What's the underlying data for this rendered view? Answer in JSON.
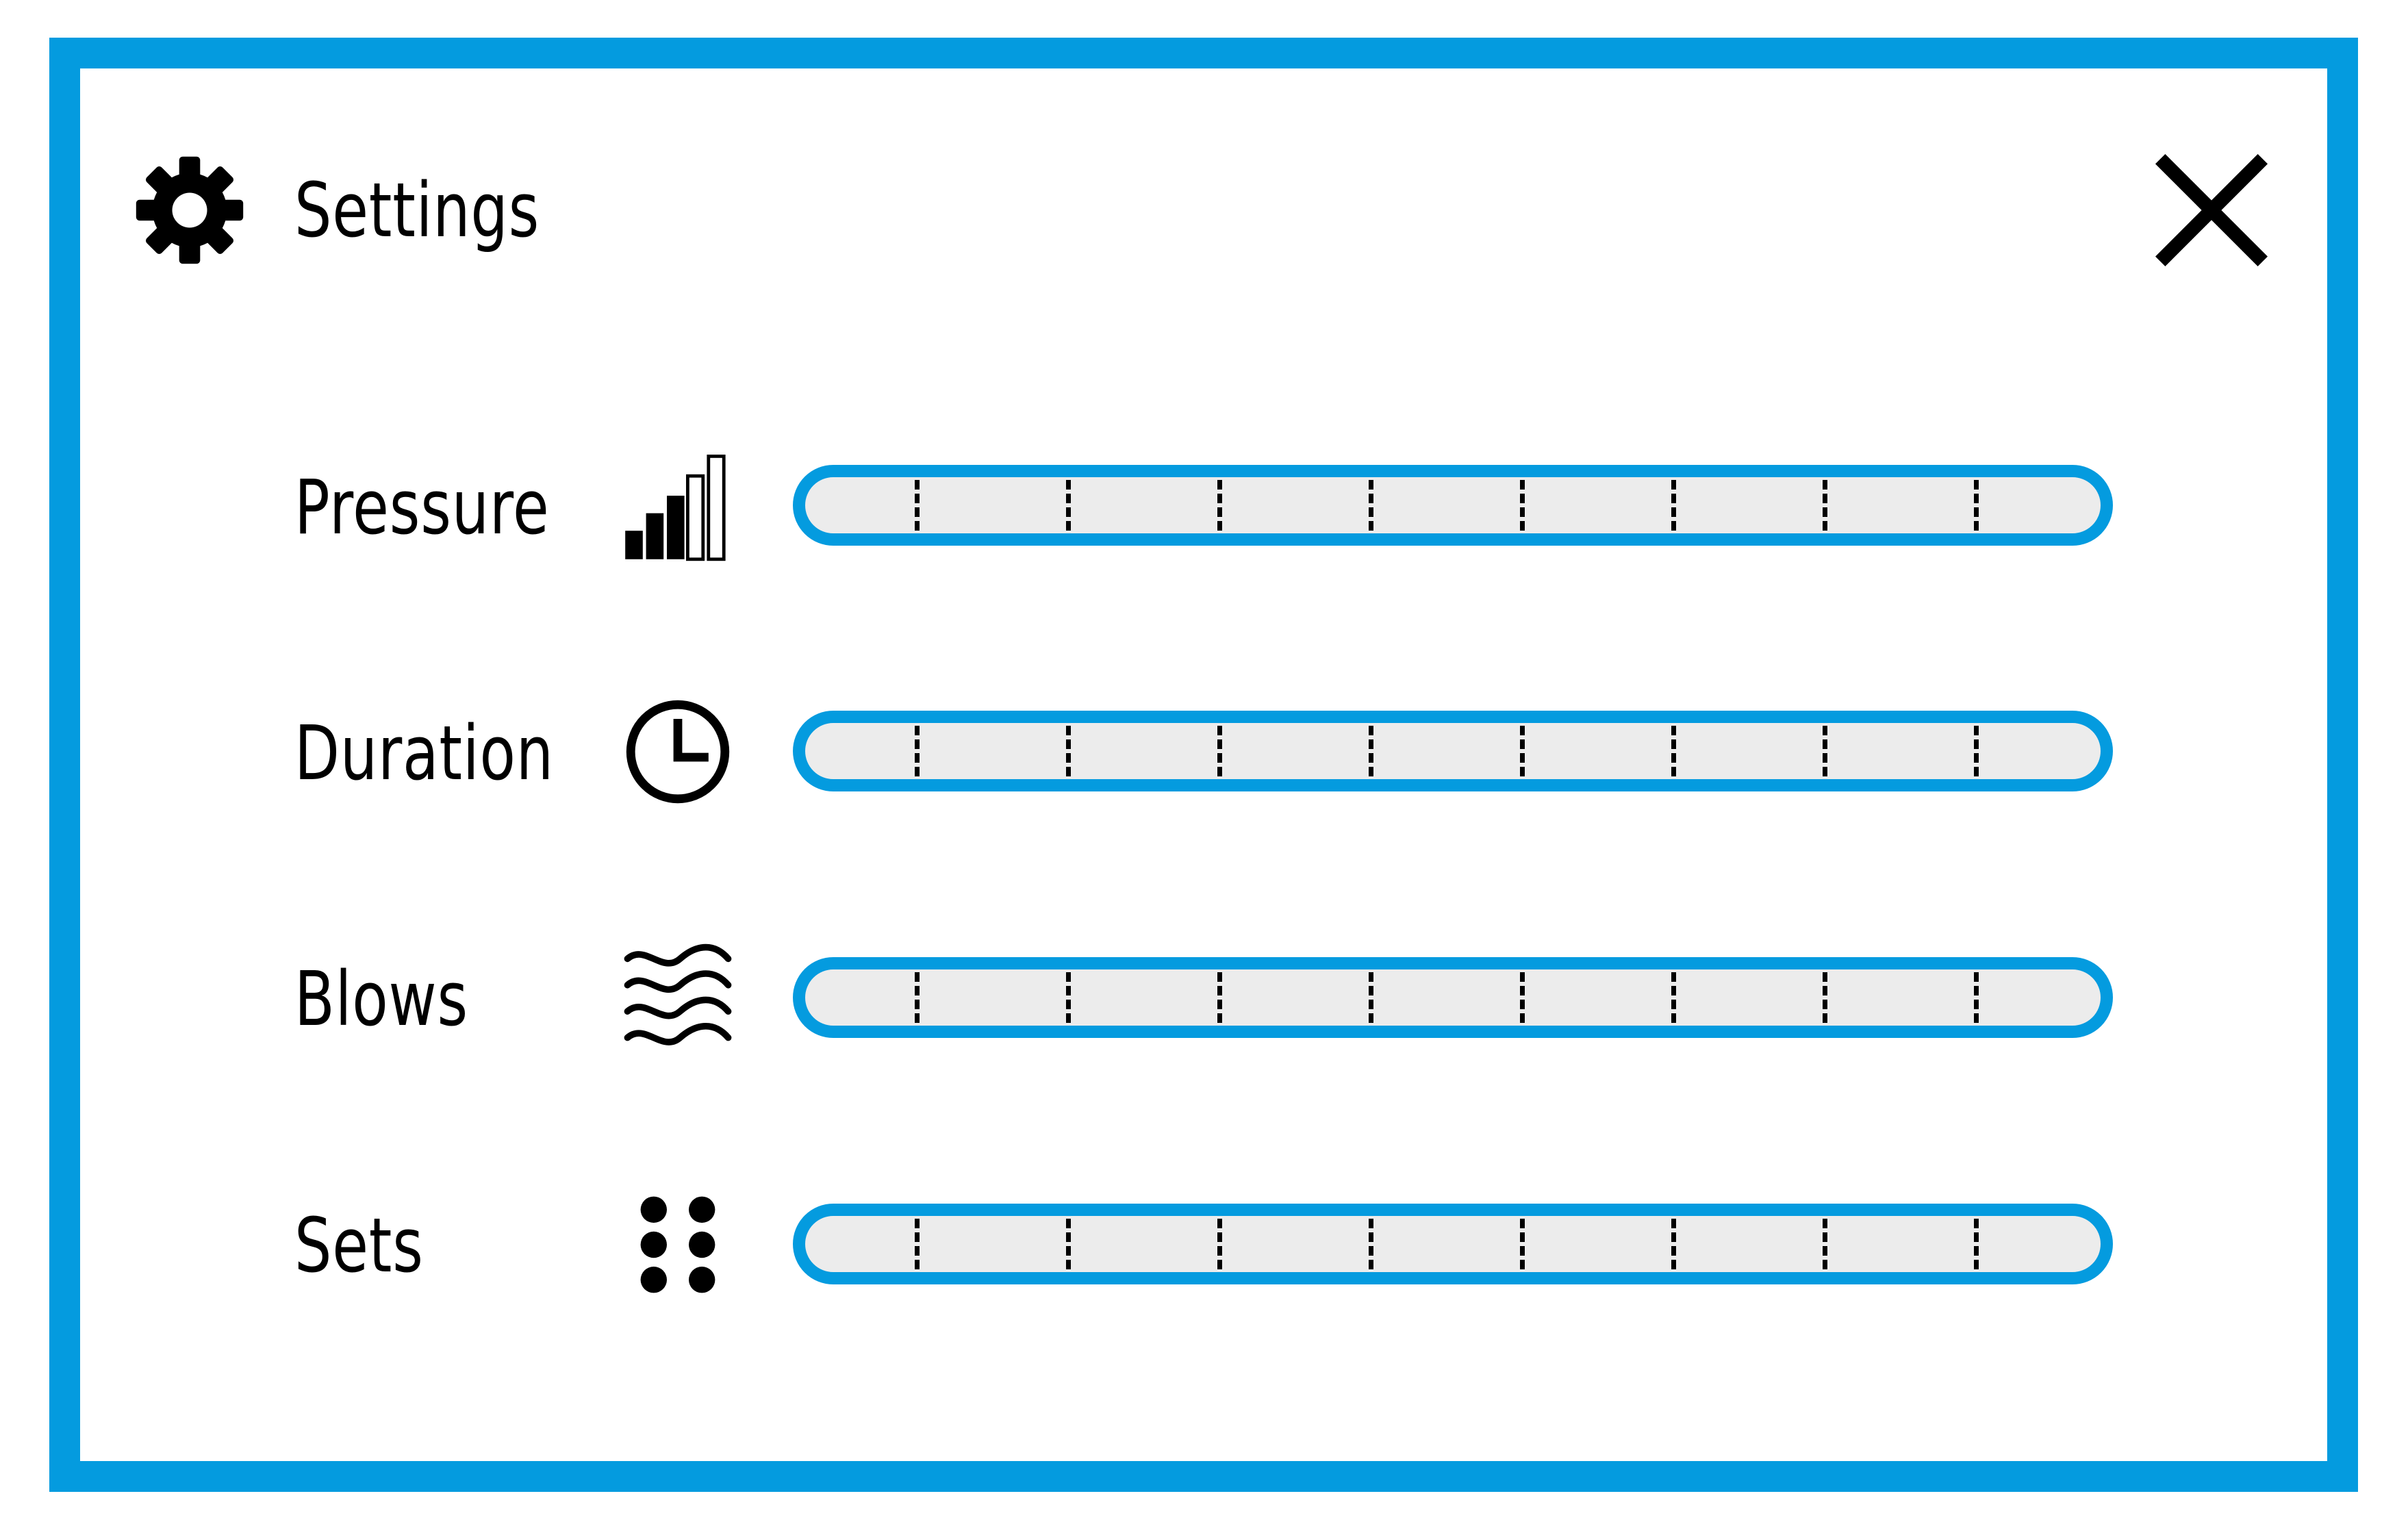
{
  "header": {
    "title": "Settings",
    "icon": "gear-icon",
    "close_icon": "close-icon"
  },
  "settings": [
    {
      "label": "Pressure",
      "icon": "signal-bars-icon"
    },
    {
      "label": "Duration",
      "icon": "clock-icon"
    },
    {
      "label": "Blows",
      "icon": "waves-icon"
    },
    {
      "label": "Sets",
      "icon": "dice-six-icon"
    }
  ],
  "slider": {
    "tick_count": 8
  },
  "colors": {
    "accent": "#049bdf",
    "track": "#ececec",
    "text": "#000000"
  }
}
